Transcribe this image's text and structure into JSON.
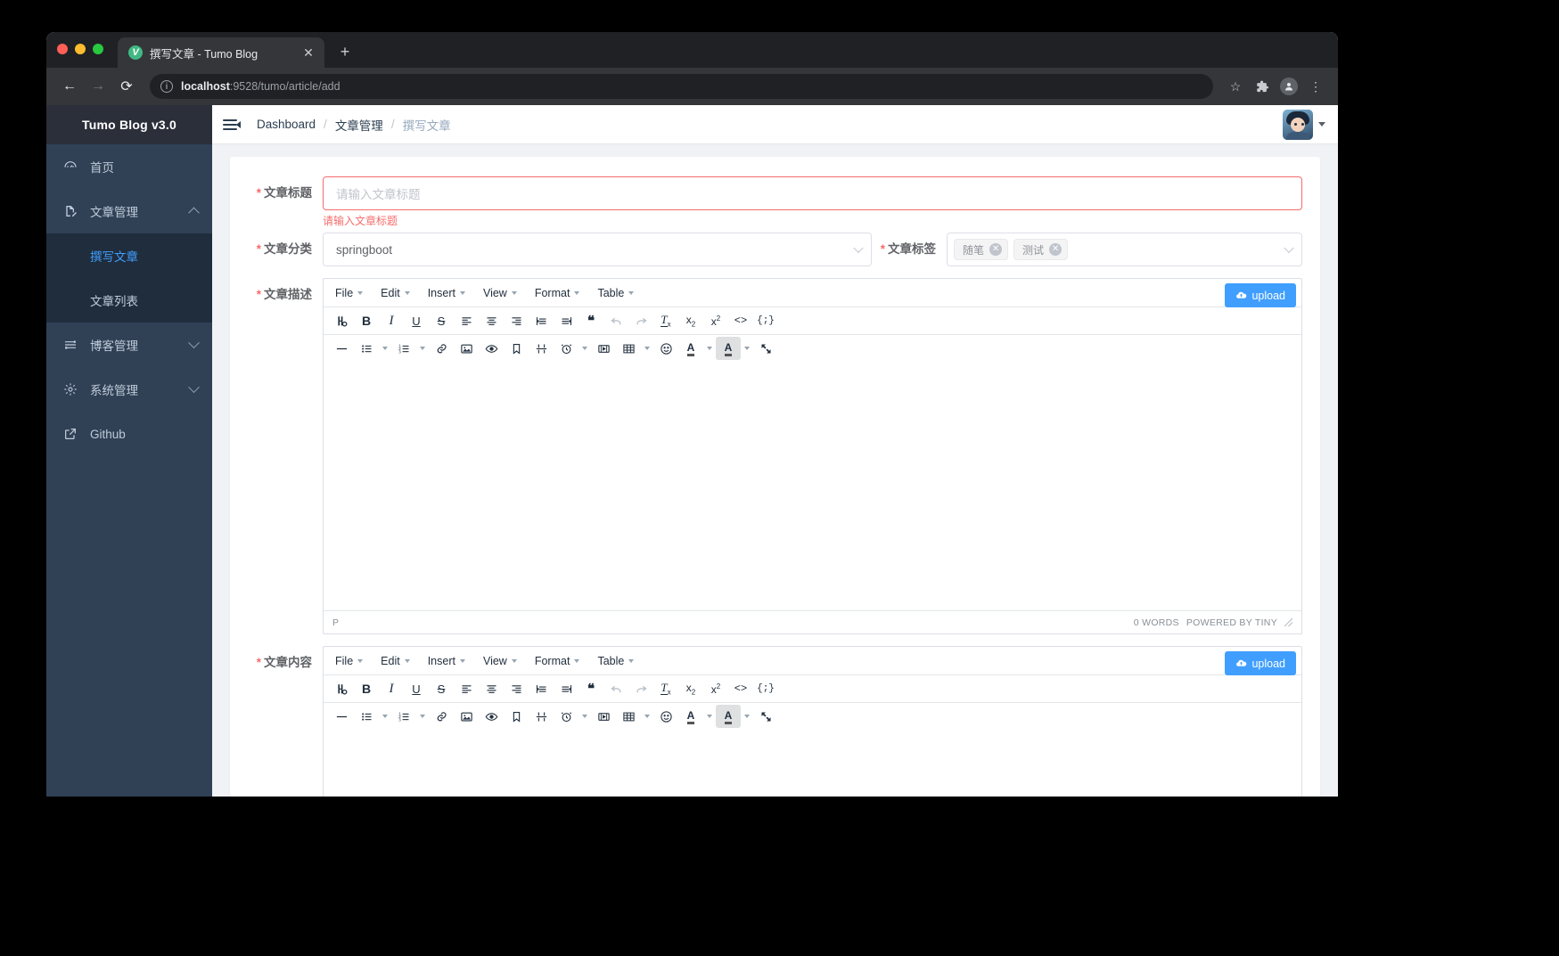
{
  "browser": {
    "tab_title": "撰写文章 - Tumo Blog",
    "favicon_letter": "V",
    "close_glyph": "✕",
    "newtab_glyph": "+",
    "back_glyph": "←",
    "forward_glyph": "→",
    "reload_glyph": "⟳",
    "info_glyph": "i",
    "url_host": "localhost",
    "url_path": ":9528/tumo/article/add",
    "star_glyph": "☆",
    "extensions_glyph": "🧩",
    "profile_glyph": "●",
    "menu_glyph": "⋮"
  },
  "sidebar": {
    "brand": "Tumo Blog v3.0",
    "items": [
      {
        "label": "首页",
        "icon": "dashboard-icon",
        "expandable": false
      },
      {
        "label": "文章管理",
        "icon": "document-edit-icon",
        "expandable": true
      },
      {
        "label": "博客管理",
        "icon": "sliders-icon",
        "expandable": true
      },
      {
        "label": "系统管理",
        "icon": "gear-icon",
        "expandable": true
      },
      {
        "label": "Github",
        "icon": "external-link-icon",
        "expandable": false
      }
    ],
    "submenu": [
      {
        "label": "撰写文章",
        "active": true
      },
      {
        "label": "文章列表",
        "active": false
      }
    ]
  },
  "navbar": {
    "hamburger_icon": "hamburger-collapse-icon",
    "breadcrumb": [
      "Dashboard",
      "文章管理",
      "撰写文章"
    ],
    "separator": "/"
  },
  "form": {
    "title": {
      "label": "文章标题",
      "required_mark": "*",
      "value": "",
      "placeholder": "请输入文章标题",
      "error": "请输入文章标题"
    },
    "category": {
      "label": "文章分类",
      "required_mark": "*",
      "value": "springboot"
    },
    "tags": {
      "label": "文章标签",
      "required_mark": "*",
      "values": [
        "随笔",
        "测试"
      ],
      "close_glyph": "✕"
    },
    "description": {
      "label": "文章描述",
      "required_mark": "*"
    },
    "content": {
      "label": "文章内容",
      "required_mark": "*"
    }
  },
  "editor": {
    "menubar": [
      "File",
      "Edit",
      "Insert",
      "View",
      "Format",
      "Table"
    ],
    "upload_label": "upload",
    "upload_icon": "cloud-upload-icon",
    "toolbar_row1": [
      {
        "name": "searchreplace-icon",
        "glyph": "searchreplace"
      },
      {
        "name": "bold-icon",
        "glyph": "B"
      },
      {
        "name": "italic-icon",
        "glyph": "I"
      },
      {
        "name": "underline-icon",
        "glyph": "U"
      },
      {
        "name": "strikethrough-icon",
        "glyph": "S"
      },
      {
        "name": "align-left-icon",
        "glyph": "alignleft"
      },
      {
        "name": "align-center-icon",
        "glyph": "aligncenter"
      },
      {
        "name": "align-right-icon",
        "glyph": "alignright"
      },
      {
        "name": "outdent-icon",
        "glyph": "outdent"
      },
      {
        "name": "indent-icon",
        "glyph": "indent"
      },
      {
        "name": "blockquote-icon",
        "glyph": "❝"
      },
      {
        "name": "undo-icon",
        "glyph": "undo"
      },
      {
        "name": "redo-icon",
        "glyph": "redo"
      },
      {
        "name": "remove-format-icon",
        "glyph": "Tx"
      },
      {
        "name": "subscript-icon",
        "glyph": "x₂"
      },
      {
        "name": "superscript-icon",
        "glyph": "x²"
      },
      {
        "name": "source-code-icon",
        "glyph": "<>"
      },
      {
        "name": "code-sample-icon",
        "glyph": "{;}"
      }
    ],
    "toolbar_row2": [
      {
        "name": "horizontal-rule-icon",
        "glyph": "—"
      },
      {
        "name": "bullet-list-icon",
        "glyph": "ul"
      },
      {
        "name": "numbered-list-icon",
        "glyph": "ol"
      },
      {
        "name": "link-icon",
        "glyph": "link"
      },
      {
        "name": "image-icon",
        "glyph": "image"
      },
      {
        "name": "preview-icon",
        "glyph": "eye"
      },
      {
        "name": "anchor-icon",
        "glyph": "bookmark"
      },
      {
        "name": "page-break-icon",
        "glyph": "pagebreak"
      },
      {
        "name": "insert-datetime-icon",
        "glyph": "clock"
      },
      {
        "name": "media-icon",
        "glyph": "media"
      },
      {
        "name": "table-icon",
        "glyph": "table"
      },
      {
        "name": "emoticon-icon",
        "glyph": "☺"
      },
      {
        "name": "text-color-icon",
        "glyph": "A"
      },
      {
        "name": "background-color-icon",
        "glyph": "A"
      },
      {
        "name": "fullscreen-icon",
        "glyph": "fullscreen"
      }
    ],
    "status_path": "P",
    "status_words": "0 WORDS",
    "status_brand": "POWERED BY TINY"
  },
  "colors": {
    "sidebar_bg": "#304156",
    "sidebar_sub_bg": "#1f2d3d",
    "accent": "#409eff",
    "danger": "#f56c6c",
    "brand_bg": "#2b2f3a"
  }
}
